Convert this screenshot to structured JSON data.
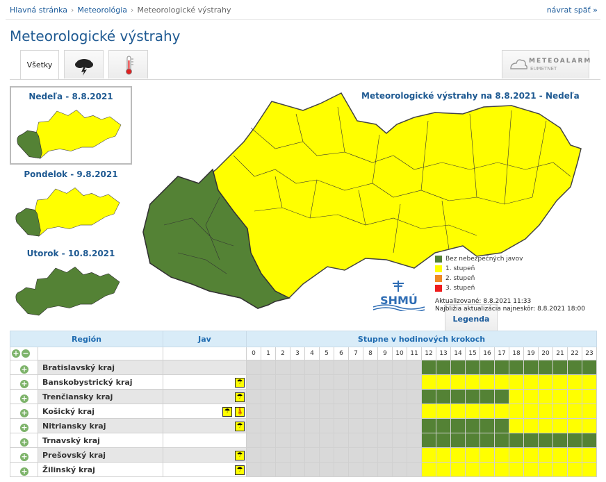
{
  "breadcrumb": {
    "home": "Hlavná stránka",
    "section": "Meteorológia",
    "current": "Meteorologické výstrahy"
  },
  "back_link": "návrat späť »",
  "page_title": "Meteorologické výstrahy",
  "tabs": {
    "all": "Všetky",
    "legend": "Legenda",
    "meteoalarm": "METEOALARM",
    "eumetnet": "EUMETNET"
  },
  "days": [
    {
      "label": "Nedeľa - 8.8.2021"
    },
    {
      "label": "Pondelok - 9.8.2021"
    },
    {
      "label": "Utorok - 10.8.2021"
    }
  ],
  "map": {
    "title": "Meteorologické výstrahy na 8.8.2021 - Nedeľa",
    "legend": [
      {
        "label": "Bez nebezpečných javov",
        "color": "#548235"
      },
      {
        "label": "1. stupeň",
        "color": "#ffff00"
      },
      {
        "label": "2. stupeň",
        "color": "#f08a24"
      },
      {
        "label": "3. stupeň",
        "color": "#ee1c1c"
      }
    ],
    "updated": "Aktualizované: 8.8.2021 11:33",
    "next_update": "Najbližia aktualizácia najneskôr: 8.8.2021 18:00",
    "logo_text": "SHMÚ"
  },
  "table": {
    "col_region": "Región",
    "col_phenomenon": "Jav",
    "col_levels": "Stupne v hodinových krokoch",
    "hours": [
      "0",
      "1",
      "2",
      "3",
      "4",
      "5",
      "6",
      "7",
      "8",
      "9",
      "10",
      "11",
      "12",
      "13",
      "14",
      "15",
      "16",
      "17",
      "18",
      "19",
      "20",
      "21",
      "22",
      "23"
    ],
    "rows": [
      {
        "name": "Bratislavský kraj",
        "icons": [],
        "cells": "nnnnnnnnnnnnggggggggggggg"
      },
      {
        "name": "Banskobystrický kraj",
        "icons": [
          "storm"
        ],
        "cells": "nnnnnnnnnnnnyyyyyyyyyyyy"
      },
      {
        "name": "Trenčiansky kraj",
        "icons": [
          "storm"
        ],
        "cells": "nnnnnnnnnnnnggggggyyyyyy"
      },
      {
        "name": "Košický kraj",
        "icons": [
          "storm",
          "heat"
        ],
        "cells": "nnnnnnnnnnnnyyyyyyyyyyyy"
      },
      {
        "name": "Nitriansky kraj",
        "icons": [
          "storm"
        ],
        "cells": "nnnnnnnnnnnnggggggyyyyyy"
      },
      {
        "name": "Trnavský kraj",
        "icons": [],
        "cells": "nnnnnnnnnnnngggggggggggg"
      },
      {
        "name": "Prešovský kraj",
        "icons": [
          "storm"
        ],
        "cells": "nnnnnnnnnnnnyyyyyyyyyyyy"
      },
      {
        "name": "Žilinský kraj",
        "icons": [
          "storm"
        ],
        "cells": "nnnnnnnnnnnnyyyyyyyyyyyy"
      }
    ]
  },
  "colors": {
    "accent": "#1f5a92",
    "green": "#548235",
    "yellow": "#ffff00",
    "inactive": "#d9d9d9"
  }
}
